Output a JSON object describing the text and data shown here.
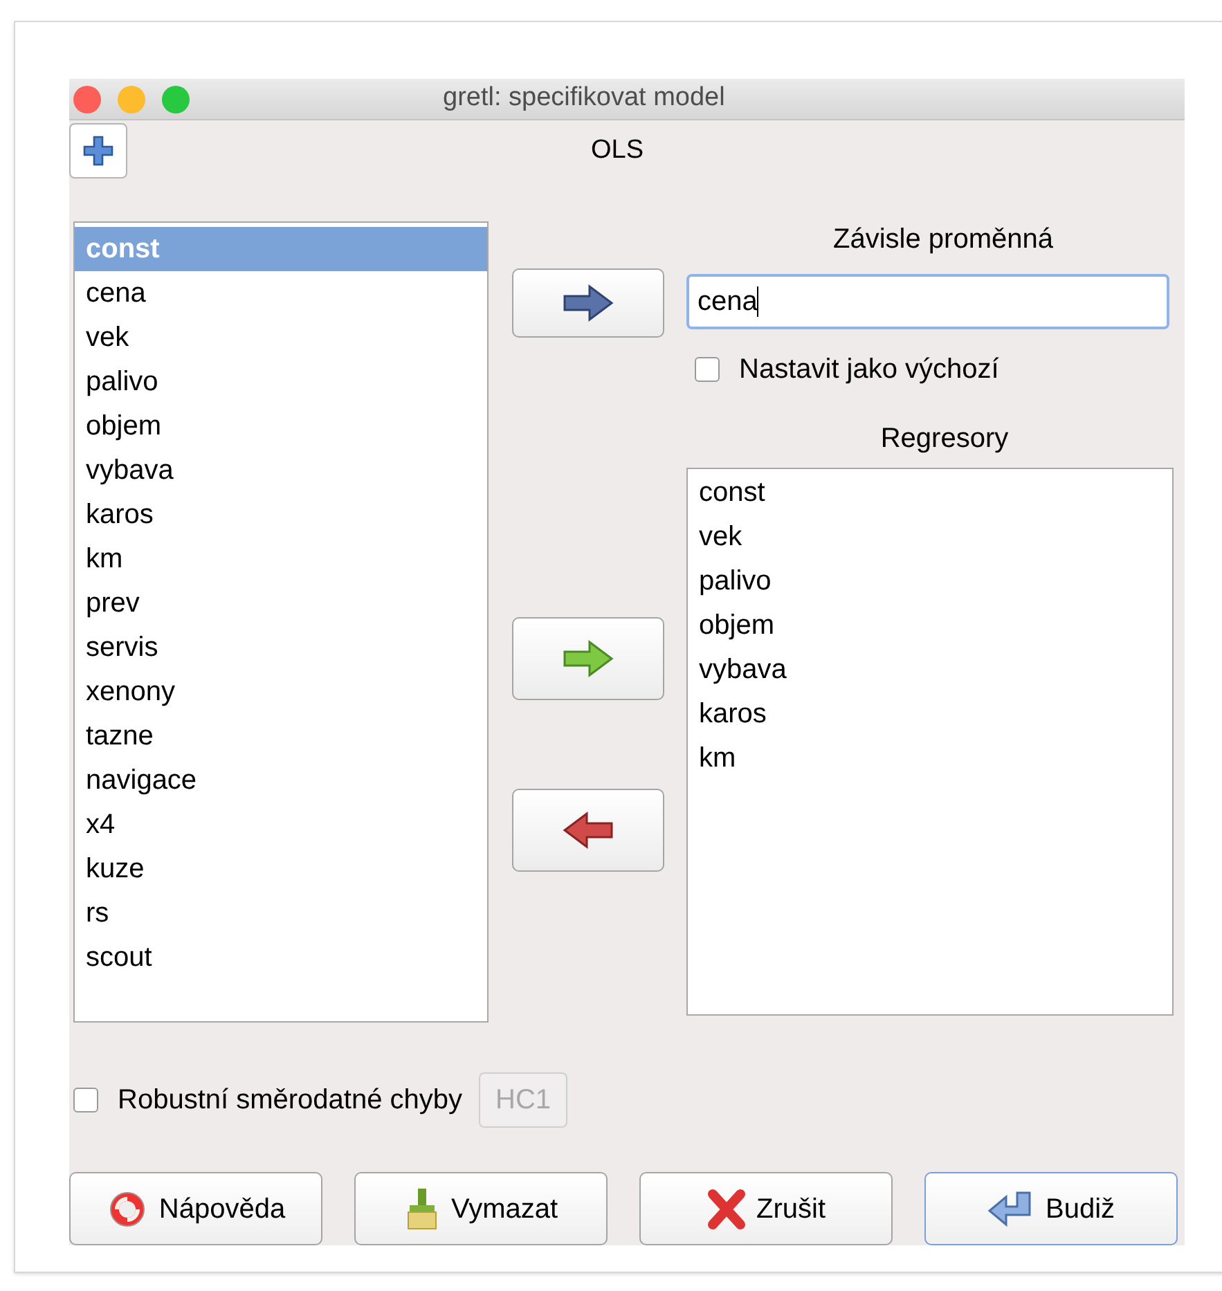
{
  "window": {
    "title": "gretl: specifikovat model"
  },
  "model_label": "OLS",
  "variables": [
    {
      "name": "const",
      "selected": true
    },
    {
      "name": "cena",
      "selected": false
    },
    {
      "name": "vek",
      "selected": false
    },
    {
      "name": "palivo",
      "selected": false
    },
    {
      "name": "objem",
      "selected": false
    },
    {
      "name": "vybava",
      "selected": false
    },
    {
      "name": "karos",
      "selected": false
    },
    {
      "name": "km",
      "selected": false
    },
    {
      "name": "prev",
      "selected": false
    },
    {
      "name": "servis",
      "selected": false
    },
    {
      "name": "xenony",
      "selected": false
    },
    {
      "name": "tazne",
      "selected": false
    },
    {
      "name": "navigace",
      "selected": false
    },
    {
      "name": "x4",
      "selected": false
    },
    {
      "name": "kuze",
      "selected": false
    },
    {
      "name": "rs",
      "selected": false
    },
    {
      "name": "scout",
      "selected": false
    }
  ],
  "dependent": {
    "label": "Závisle proměnná",
    "value": "cena",
    "default_checkbox": {
      "label": "Nastavit jako výchozí",
      "checked": false
    }
  },
  "regressors": {
    "label": "Regresory",
    "items": [
      "const",
      "vek",
      "palivo",
      "objem",
      "vybava",
      "karos",
      "km"
    ]
  },
  "robust": {
    "label": "Robustní směrodatné chyby",
    "checked": false,
    "option": {
      "label": "HC1",
      "disabled": true
    }
  },
  "buttons": [
    {
      "kind": "help",
      "label": "Nápověda",
      "default": false
    },
    {
      "kind": "clear",
      "label": "Vymazat",
      "default": false
    },
    {
      "kind": "cancel",
      "label": "Zrušit",
      "default": false
    },
    {
      "kind": "ok",
      "label": "Budiž",
      "default": true
    }
  ]
}
